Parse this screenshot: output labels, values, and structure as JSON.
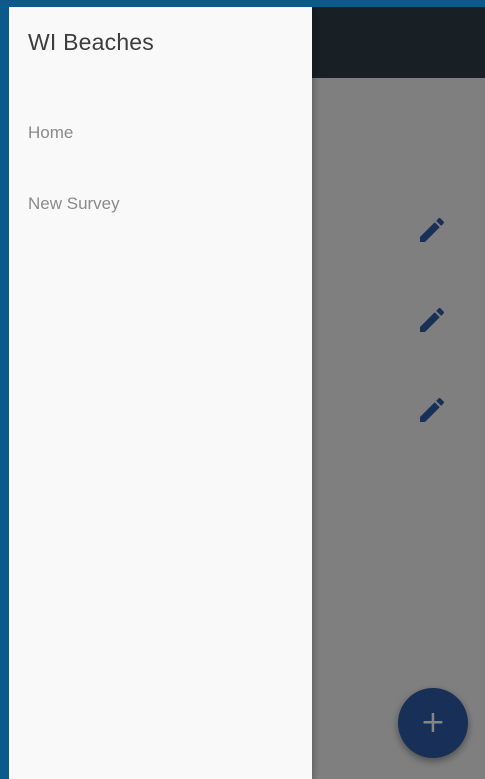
{
  "drawer": {
    "title": "WI Beaches",
    "items": [
      {
        "label": "Home"
      },
      {
        "label": "New Survey"
      }
    ]
  },
  "list": {
    "rows": [
      {
        "icon": "edit-icon"
      },
      {
        "icon": "edit-icon"
      },
      {
        "icon": "edit-icon"
      }
    ]
  },
  "fab": {
    "icon": "plus-icon",
    "symbol": "+"
  },
  "colors": {
    "frame": "#0b5a8a",
    "appbar": "#2f3f47",
    "accent": "#2e5aa8",
    "drawer_bg": "#f9f9f9"
  }
}
